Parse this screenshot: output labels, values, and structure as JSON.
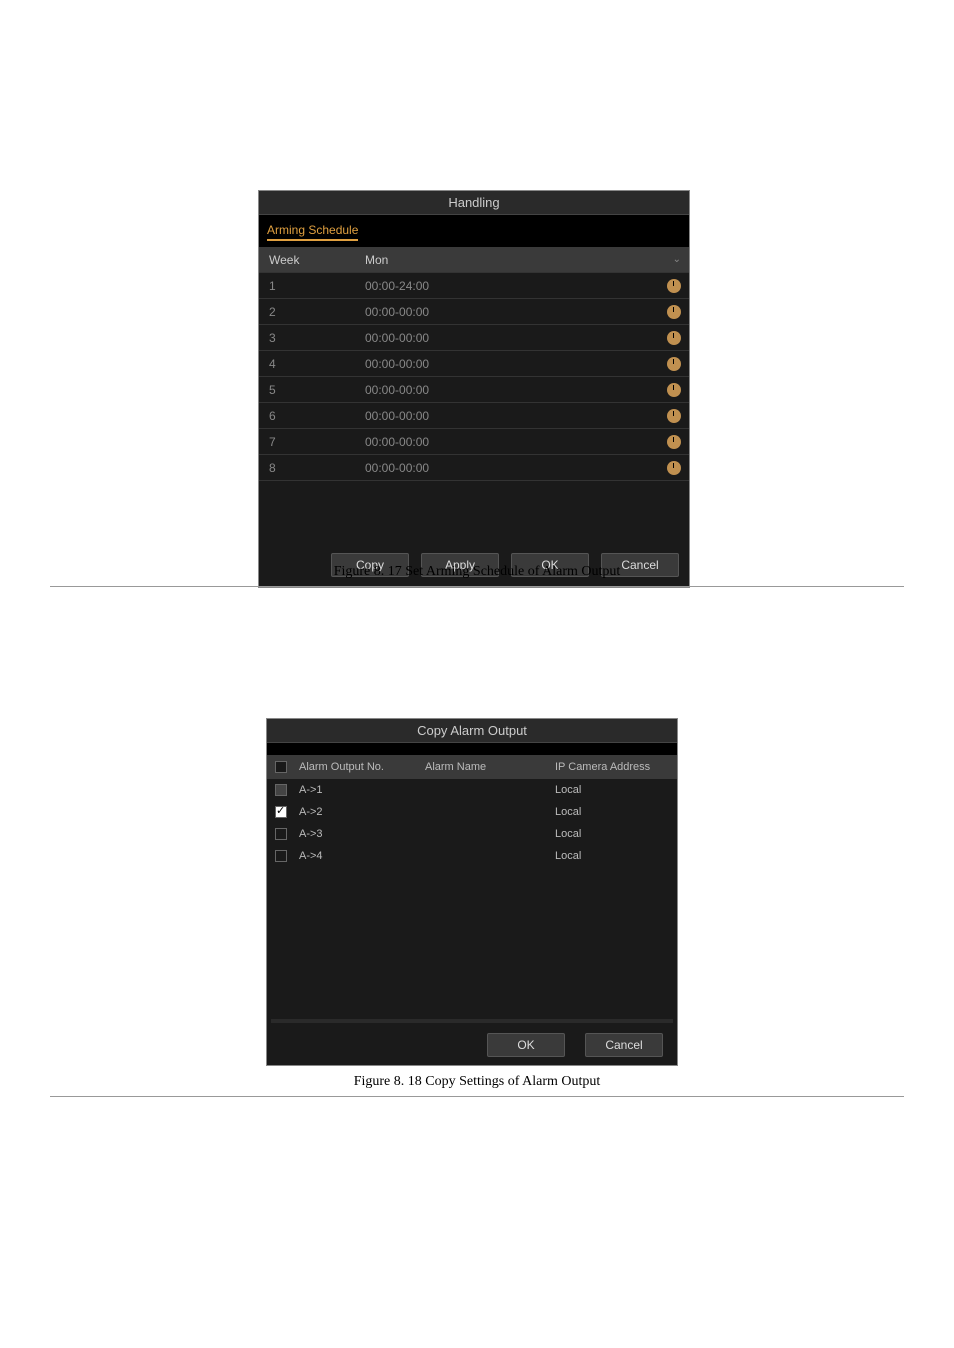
{
  "dialog1": {
    "title": "Handling",
    "tab": "Arming Schedule",
    "week_label": "Week",
    "week_value": "Mon",
    "rows": [
      {
        "n": "1",
        "t": "00:00-24:00"
      },
      {
        "n": "2",
        "t": "00:00-00:00"
      },
      {
        "n": "3",
        "t": "00:00-00:00"
      },
      {
        "n": "4",
        "t": "00:00-00:00"
      },
      {
        "n": "5",
        "t": "00:00-00:00"
      },
      {
        "n": "6",
        "t": "00:00-00:00"
      },
      {
        "n": "7",
        "t": "00:00-00:00"
      },
      {
        "n": "8",
        "t": "00:00-00:00"
      }
    ],
    "buttons": {
      "copy": "Copy",
      "apply": "Apply",
      "ok": "OK",
      "cancel": "Cancel"
    }
  },
  "caption1": "Figure 8. 17 Set Arming Schedule of Alarm Output",
  "dialog2": {
    "title": "Copy Alarm Output",
    "headers": {
      "no": "Alarm Output No.",
      "name": "Alarm Name",
      "addr": "IP Camera Address"
    },
    "rows": [
      {
        "no": "A->1",
        "name": "",
        "addr": "Local",
        "state": "disabled"
      },
      {
        "no": "A->2",
        "name": "",
        "addr": "Local",
        "state": "checked"
      },
      {
        "no": "A->3",
        "name": "",
        "addr": "Local",
        "state": "unchecked"
      },
      {
        "no": "A->4",
        "name": "",
        "addr": "Local",
        "state": "unchecked"
      }
    ],
    "buttons": {
      "ok": "OK",
      "cancel": "Cancel"
    }
  },
  "caption2": "Figure 8. 18 Copy Settings of Alarm Output"
}
